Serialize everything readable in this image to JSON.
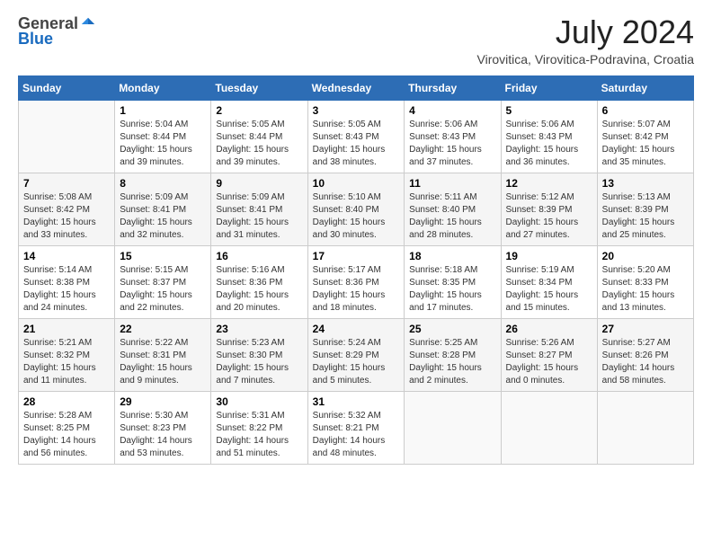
{
  "logo": {
    "general": "General",
    "blue": "Blue"
  },
  "header": {
    "month": "July 2024",
    "location": "Virovitica, Virovitica-Podravina, Croatia"
  },
  "weekdays": [
    "Sunday",
    "Monday",
    "Tuesday",
    "Wednesday",
    "Thursday",
    "Friday",
    "Saturday"
  ],
  "weeks": [
    [
      {
        "day": "",
        "info": ""
      },
      {
        "day": "1",
        "info": "Sunrise: 5:04 AM\nSunset: 8:44 PM\nDaylight: 15 hours\nand 39 minutes."
      },
      {
        "day": "2",
        "info": "Sunrise: 5:05 AM\nSunset: 8:44 PM\nDaylight: 15 hours\nand 39 minutes."
      },
      {
        "day": "3",
        "info": "Sunrise: 5:05 AM\nSunset: 8:43 PM\nDaylight: 15 hours\nand 38 minutes."
      },
      {
        "day": "4",
        "info": "Sunrise: 5:06 AM\nSunset: 8:43 PM\nDaylight: 15 hours\nand 37 minutes."
      },
      {
        "day": "5",
        "info": "Sunrise: 5:06 AM\nSunset: 8:43 PM\nDaylight: 15 hours\nand 36 minutes."
      },
      {
        "day": "6",
        "info": "Sunrise: 5:07 AM\nSunset: 8:42 PM\nDaylight: 15 hours\nand 35 minutes."
      }
    ],
    [
      {
        "day": "7",
        "info": "Sunrise: 5:08 AM\nSunset: 8:42 PM\nDaylight: 15 hours\nand 33 minutes."
      },
      {
        "day": "8",
        "info": "Sunrise: 5:09 AM\nSunset: 8:41 PM\nDaylight: 15 hours\nand 32 minutes."
      },
      {
        "day": "9",
        "info": "Sunrise: 5:09 AM\nSunset: 8:41 PM\nDaylight: 15 hours\nand 31 minutes."
      },
      {
        "day": "10",
        "info": "Sunrise: 5:10 AM\nSunset: 8:40 PM\nDaylight: 15 hours\nand 30 minutes."
      },
      {
        "day": "11",
        "info": "Sunrise: 5:11 AM\nSunset: 8:40 PM\nDaylight: 15 hours\nand 28 minutes."
      },
      {
        "day": "12",
        "info": "Sunrise: 5:12 AM\nSunset: 8:39 PM\nDaylight: 15 hours\nand 27 minutes."
      },
      {
        "day": "13",
        "info": "Sunrise: 5:13 AM\nSunset: 8:39 PM\nDaylight: 15 hours\nand 25 minutes."
      }
    ],
    [
      {
        "day": "14",
        "info": "Sunrise: 5:14 AM\nSunset: 8:38 PM\nDaylight: 15 hours\nand 24 minutes."
      },
      {
        "day": "15",
        "info": "Sunrise: 5:15 AM\nSunset: 8:37 PM\nDaylight: 15 hours\nand 22 minutes."
      },
      {
        "day": "16",
        "info": "Sunrise: 5:16 AM\nSunset: 8:36 PM\nDaylight: 15 hours\nand 20 minutes."
      },
      {
        "day": "17",
        "info": "Sunrise: 5:17 AM\nSunset: 8:36 PM\nDaylight: 15 hours\nand 18 minutes."
      },
      {
        "day": "18",
        "info": "Sunrise: 5:18 AM\nSunset: 8:35 PM\nDaylight: 15 hours\nand 17 minutes."
      },
      {
        "day": "19",
        "info": "Sunrise: 5:19 AM\nSunset: 8:34 PM\nDaylight: 15 hours\nand 15 minutes."
      },
      {
        "day": "20",
        "info": "Sunrise: 5:20 AM\nSunset: 8:33 PM\nDaylight: 15 hours\nand 13 minutes."
      }
    ],
    [
      {
        "day": "21",
        "info": "Sunrise: 5:21 AM\nSunset: 8:32 PM\nDaylight: 15 hours\nand 11 minutes."
      },
      {
        "day": "22",
        "info": "Sunrise: 5:22 AM\nSunset: 8:31 PM\nDaylight: 15 hours\nand 9 minutes."
      },
      {
        "day": "23",
        "info": "Sunrise: 5:23 AM\nSunset: 8:30 PM\nDaylight: 15 hours\nand 7 minutes."
      },
      {
        "day": "24",
        "info": "Sunrise: 5:24 AM\nSunset: 8:29 PM\nDaylight: 15 hours\nand 5 minutes."
      },
      {
        "day": "25",
        "info": "Sunrise: 5:25 AM\nSunset: 8:28 PM\nDaylight: 15 hours\nand 2 minutes."
      },
      {
        "day": "26",
        "info": "Sunrise: 5:26 AM\nSunset: 8:27 PM\nDaylight: 15 hours\nand 0 minutes."
      },
      {
        "day": "27",
        "info": "Sunrise: 5:27 AM\nSunset: 8:26 PM\nDaylight: 14 hours\nand 58 minutes."
      }
    ],
    [
      {
        "day": "28",
        "info": "Sunrise: 5:28 AM\nSunset: 8:25 PM\nDaylight: 14 hours\nand 56 minutes."
      },
      {
        "day": "29",
        "info": "Sunrise: 5:30 AM\nSunset: 8:23 PM\nDaylight: 14 hours\nand 53 minutes."
      },
      {
        "day": "30",
        "info": "Sunrise: 5:31 AM\nSunset: 8:22 PM\nDaylight: 14 hours\nand 51 minutes."
      },
      {
        "day": "31",
        "info": "Sunrise: 5:32 AM\nSunset: 8:21 PM\nDaylight: 14 hours\nand 48 minutes."
      },
      {
        "day": "",
        "info": ""
      },
      {
        "day": "",
        "info": ""
      },
      {
        "day": "",
        "info": ""
      }
    ]
  ]
}
